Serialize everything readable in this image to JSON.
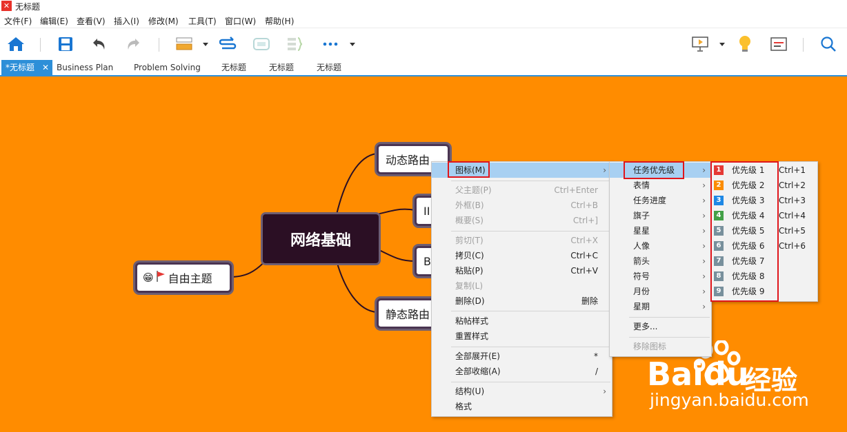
{
  "app": {
    "title": "无标题"
  },
  "menubar": [
    "文件(F)",
    "编辑(E)",
    "查看(V)",
    "插入(I)",
    "修改(M)",
    "工具(T)",
    "窗口(W)",
    "帮助(H)"
  ],
  "tabs": [
    {
      "label": "*无标题",
      "active": true
    },
    {
      "label": "Business Plan"
    },
    {
      "label": "Problem Solving"
    },
    {
      "label": "无标题"
    },
    {
      "label": "无标题"
    },
    {
      "label": "无标题"
    }
  ],
  "tab_close": "✕",
  "mindmap": {
    "central": "网络基础",
    "topic_dynamic": "动态路由",
    "topic_ip": "II",
    "topic_b": "B",
    "topic_static": "静态路由",
    "free_topic": "自由主题",
    "free_topic_icons": [
      "😁",
      "🚩"
    ]
  },
  "context_menu": {
    "items": [
      {
        "label": "图标(M)",
        "shortcut": "",
        "arrow": "›",
        "highlighted": true
      },
      {
        "label": "父主题(P)",
        "shortcut": "Ctrl+Enter",
        "disabled": true
      },
      {
        "label": "外框(B)",
        "shortcut": "Ctrl+B",
        "disabled": true
      },
      {
        "label": "概要(S)",
        "shortcut": "Ctrl+]",
        "disabled": true
      },
      {
        "label": "剪切(T)",
        "shortcut": "Ctrl+X",
        "disabled": true
      },
      {
        "label": "拷贝(C)",
        "shortcut": "Ctrl+C"
      },
      {
        "label": "粘贴(P)",
        "shortcut": "Ctrl+V"
      },
      {
        "label": "复制(L)",
        "shortcut": "",
        "disabled": true
      },
      {
        "label": "删除(D)",
        "shortcut": "删除"
      },
      {
        "label": "粘帖样式",
        "shortcut": ""
      },
      {
        "label": "重置样式",
        "shortcut": ""
      },
      {
        "label": "全部展开(E)",
        "shortcut": "*"
      },
      {
        "label": "全部收缩(A)",
        "shortcut": "/"
      },
      {
        "label": "结构(U)",
        "shortcut": "",
        "arrow": "›"
      },
      {
        "label": "格式",
        "shortcut": ""
      }
    ]
  },
  "icon_submenu": {
    "items": [
      {
        "label": "任务优先级",
        "highlighted": true
      },
      {
        "label": "表情"
      },
      {
        "label": "任务进度"
      },
      {
        "label": "旗子"
      },
      {
        "label": "星星"
      },
      {
        "label": "人像"
      },
      {
        "label": "箭头"
      },
      {
        "label": "符号"
      },
      {
        "label": "月份"
      },
      {
        "label": "星期"
      }
    ],
    "more": "更多...",
    "remove": "移除图标",
    "arrow": "›"
  },
  "priority_submenu": {
    "items": [
      {
        "num": "1",
        "label": "优先级 1",
        "shortcut": "Ctrl+1",
        "color": "#e53935"
      },
      {
        "num": "2",
        "label": "优先级 2",
        "shortcut": "Ctrl+2",
        "color": "#fb8c00"
      },
      {
        "num": "3",
        "label": "优先级 3",
        "shortcut": "Ctrl+3",
        "color": "#1e88e5"
      },
      {
        "num": "4",
        "label": "优先级 4",
        "shortcut": "Ctrl+4",
        "color": "#43a047"
      },
      {
        "num": "5",
        "label": "优先级 5",
        "shortcut": "Ctrl+5",
        "color": "#78909c"
      },
      {
        "num": "6",
        "label": "优先级 6",
        "shortcut": "Ctrl+6",
        "color": "#78909c"
      },
      {
        "num": "7",
        "label": "优先级 7",
        "shortcut": "",
        "color": "#78909c"
      },
      {
        "num": "8",
        "label": "优先级 8",
        "shortcut": "",
        "color": "#78909c"
      },
      {
        "num": "9",
        "label": "优先级 9",
        "shortcut": "",
        "color": "#78909c"
      }
    ]
  },
  "watermark": {
    "brand": "Bai",
    "brand2": "du",
    "cn": "经验",
    "url": "jingyan.baidu.com"
  },
  "colors": {
    "canvas": "#ff8c00",
    "accent": "#2d8fd8",
    "highlight": "#a8d0f2",
    "annotation": "#e0151b"
  }
}
